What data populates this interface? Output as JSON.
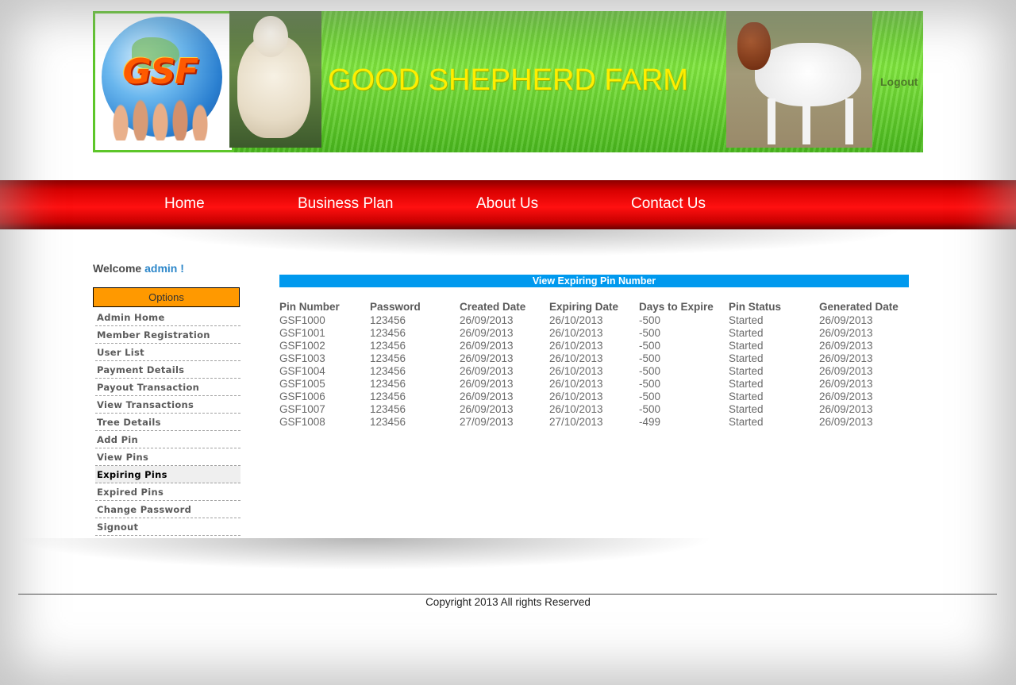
{
  "header": {
    "logo_text": "GSF",
    "site_title": "GOOD SHEPHERD FARM",
    "logout_label": "Logout"
  },
  "nav": {
    "items": [
      {
        "label": "Home"
      },
      {
        "label": "Business Plan"
      },
      {
        "label": "About Us"
      },
      {
        "label": "Contact Us"
      }
    ]
  },
  "sidebar": {
    "welcome_prefix": "Welcome",
    "username": "admin !",
    "options_label": "Options",
    "items": [
      {
        "label": "Admin Home"
      },
      {
        "label": "Member Registration"
      },
      {
        "label": "User List"
      },
      {
        "label": "Payment Details"
      },
      {
        "label": "Payout Transaction"
      },
      {
        "label": "View Transactions"
      },
      {
        "label": "Tree Details"
      },
      {
        "label": "Add Pin"
      },
      {
        "label": "View Pins"
      },
      {
        "label": "Expiring Pins"
      },
      {
        "label": "Expired Pins"
      },
      {
        "label": "Change Password"
      },
      {
        "label": "Signout"
      }
    ],
    "active_item": "Expiring Pins"
  },
  "main": {
    "panel_title": "View Expiring Pin Number",
    "columns": [
      "Pin Number",
      "Password",
      "Created Date",
      "Expiring Date",
      "Days to Expire",
      "Pin Status",
      "Generated Date"
    ],
    "rows": [
      [
        "GSF1000",
        "123456",
        "26/09/2013",
        "26/10/2013",
        "-500",
        "Started",
        "26/09/2013"
      ],
      [
        "GSF1001",
        "123456",
        "26/09/2013",
        "26/10/2013",
        "-500",
        "Started",
        "26/09/2013"
      ],
      [
        "GSF1002",
        "123456",
        "26/09/2013",
        "26/10/2013",
        "-500",
        "Started",
        "26/09/2013"
      ],
      [
        "GSF1003",
        "123456",
        "26/09/2013",
        "26/10/2013",
        "-500",
        "Started",
        "26/09/2013"
      ],
      [
        "GSF1004",
        "123456",
        "26/09/2013",
        "26/10/2013",
        "-500",
        "Started",
        "26/09/2013"
      ],
      [
        "GSF1005",
        "123456",
        "26/09/2013",
        "26/10/2013",
        "-500",
        "Started",
        "26/09/2013"
      ],
      [
        "GSF1006",
        "123456",
        "26/09/2013",
        "26/10/2013",
        "-500",
        "Started",
        "26/09/2013"
      ],
      [
        "GSF1007",
        "123456",
        "26/09/2013",
        "26/10/2013",
        "-500",
        "Started",
        "26/09/2013"
      ],
      [
        "GSF1008",
        "123456",
        "27/09/2013",
        "27/10/2013",
        "-499",
        "Started",
        "26/09/2013"
      ]
    ]
  },
  "footer": {
    "copyright": "Copyright 2013 All rights Reserved"
  },
  "colors": {
    "nav_red": "#ff1010",
    "options_orange": "#ff9900",
    "panel_blue": "#0099ee",
    "title_yellow": "#ffee00",
    "banner_green": "#6fd735"
  }
}
